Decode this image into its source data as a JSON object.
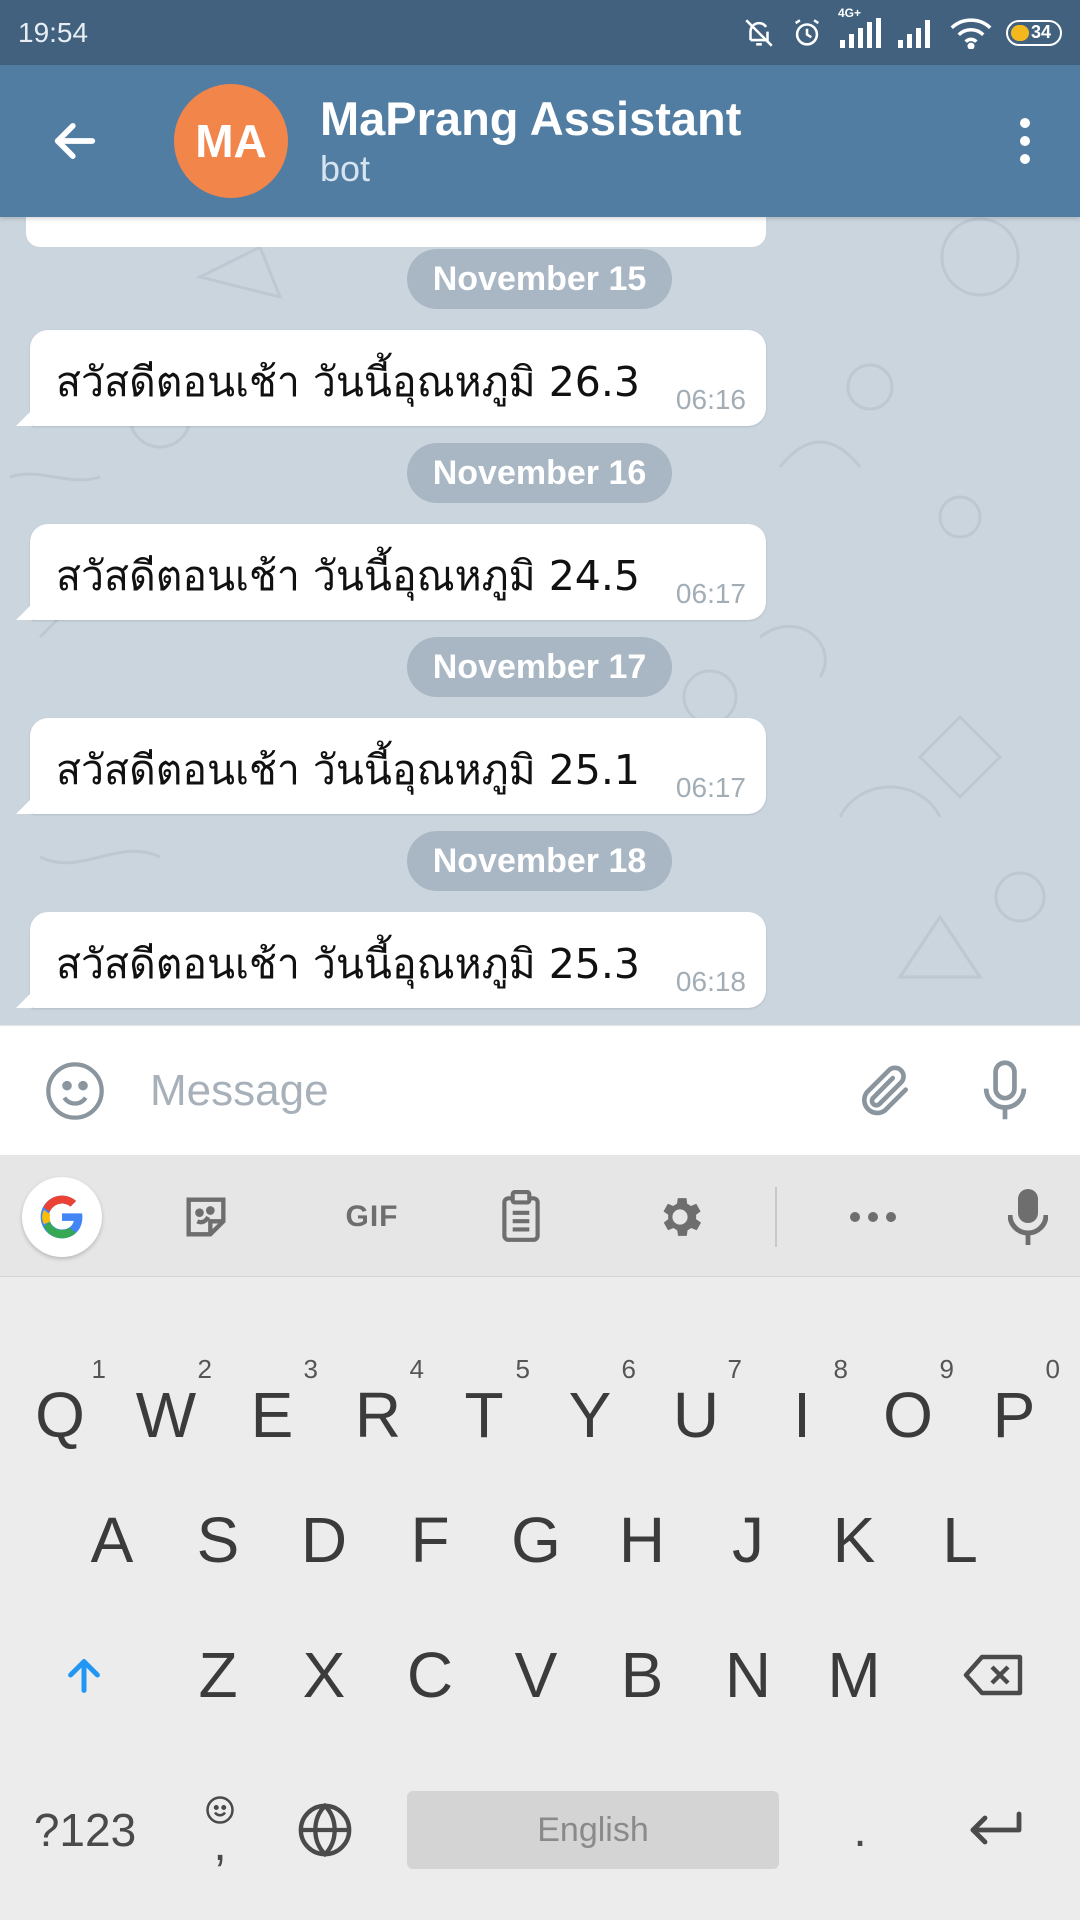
{
  "status_bar": {
    "time": "19:54",
    "network_label": "4G+",
    "battery": "34"
  },
  "header": {
    "avatar_initials": "MA",
    "title": "MaPrang Assistant",
    "subtitle": "bot",
    "avatar_color": "#f2854a",
    "bar_color": "#527da3"
  },
  "messages": [
    {
      "date": "November 15",
      "text": "สวัสดีตอนเช้า วันนี้อุณหภูมิ 26.3",
      "time": "06:16"
    },
    {
      "date": "November 16",
      "text": "สวัสดีตอนเช้า วันนี้อุณหภูมิ 24.5",
      "time": "06:17"
    },
    {
      "date": "November 17",
      "text": "สวัสดีตอนเช้า วันนี้อุณหภูมิ 25.1",
      "time": "06:17"
    },
    {
      "date": "November 18",
      "text": "สวัสดีตอนเช้า วันนี้อุณหภูมิ 25.3",
      "time": "06:18"
    }
  ],
  "composer": {
    "placeholder": "Message"
  },
  "keyboard": {
    "toolbar": {
      "gif_label": "GIF"
    },
    "row1": [
      {
        "key": "Q",
        "hint": "1"
      },
      {
        "key": "W",
        "hint": "2"
      },
      {
        "key": "E",
        "hint": "3"
      },
      {
        "key": "R",
        "hint": "4"
      },
      {
        "key": "T",
        "hint": "5"
      },
      {
        "key": "Y",
        "hint": "6"
      },
      {
        "key": "U",
        "hint": "7"
      },
      {
        "key": "I",
        "hint": "8"
      },
      {
        "key": "O",
        "hint": "9"
      },
      {
        "key": "P",
        "hint": "0"
      }
    ],
    "row2": [
      "A",
      "S",
      "D",
      "F",
      "G",
      "H",
      "J",
      "K",
      "L"
    ],
    "row3": [
      "Z",
      "X",
      "C",
      "V",
      "B",
      "N",
      "M"
    ],
    "symbols_label": "?123",
    "comma_label": ",",
    "space_label": "English",
    "period_label": "."
  }
}
